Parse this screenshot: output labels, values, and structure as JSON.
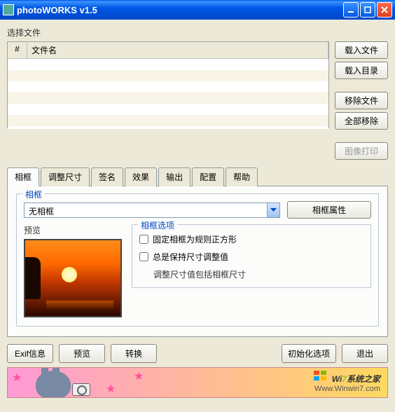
{
  "window": {
    "title": "photoWORKS v1.5"
  },
  "section_label": "选择文件",
  "table": {
    "col_num": "#",
    "col_name": "文件名"
  },
  "side_buttons": {
    "load_files": "载入文件",
    "load_dir": "载入目录",
    "remove_file": "移除文件",
    "remove_all": "全部移除",
    "print_image": "图像打印"
  },
  "tabs": {
    "frame": "相框",
    "resize": "调整尺寸",
    "signature": "签名",
    "effect": "效果",
    "output": "输出",
    "config": "配置",
    "help": "帮助"
  },
  "frame_panel": {
    "legend": "相框",
    "combo_value": "无相框",
    "props_btn": "相框属性",
    "preview_label": "预览",
    "options_legend": "相框选项",
    "opt_square": "固定相框为规则正方形",
    "opt_keep": "总是保持尺寸调整值",
    "opt_keep_sub": "调整尺寸值包括相框尺寸"
  },
  "bottom": {
    "exif": "Exif信息",
    "preview": "预览",
    "convert": "转换",
    "init_opts": "初始化选项",
    "exit": "退出"
  },
  "banner": {
    "line1a": "Wi",
    "seven": "7",
    "line1b": "系统之家",
    "line2": "Www.Winwin7.com"
  }
}
